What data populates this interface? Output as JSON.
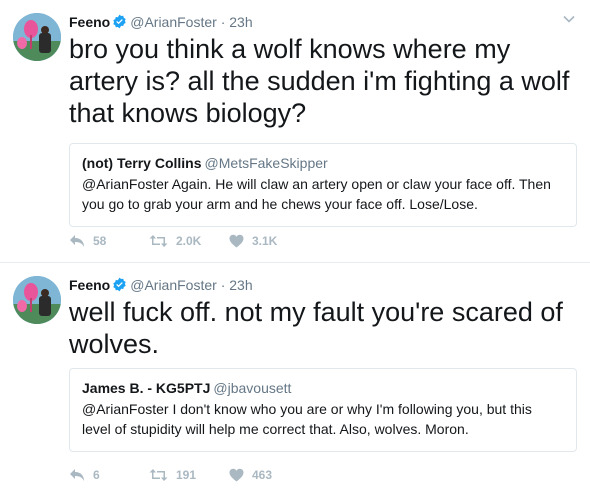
{
  "tweets": [
    {
      "author": {
        "name": "Feeno",
        "handle": "@ArianFoster",
        "time": "23h"
      },
      "text": "bro you think a wolf knows where my artery is? all the sudden i'm fighting a wolf that knows biology?",
      "quote": {
        "name": "(not) Terry Collins",
        "handle": "@MetsFakeSkipper",
        "text": "@ArianFoster Again. He will claw an artery open or claw your face off. Then you go to grab your arm and he chews your face off. Lose/Lose."
      },
      "actions": {
        "replies": "58",
        "retweets": "2.0K",
        "likes": "3.1K"
      }
    },
    {
      "author": {
        "name": "Feeno",
        "handle": "@ArianFoster",
        "time": "23h"
      },
      "text": "well fuck off. not my fault you're scared of wolves.",
      "quote": {
        "name": "James B. - KG5PTJ",
        "handle": "@jbavousett",
        "text": "@ArianFoster I don't know who you are or why I'm following you, but this level of stupidity will help me correct that. Also, wolves.  Moron."
      },
      "actions": {
        "replies": "6",
        "retweets": "191",
        "likes": "463"
      }
    }
  ],
  "separator": "·",
  "colors": {
    "text": "#14171a",
    "secondary": "#657786",
    "action": "#aab8c2",
    "verified": "#1da1f2",
    "border": "#e1e8ed"
  },
  "icons": [
    "verified-badge-icon",
    "chevron-down-icon",
    "reply-icon",
    "retweet-icon",
    "like-icon"
  ]
}
